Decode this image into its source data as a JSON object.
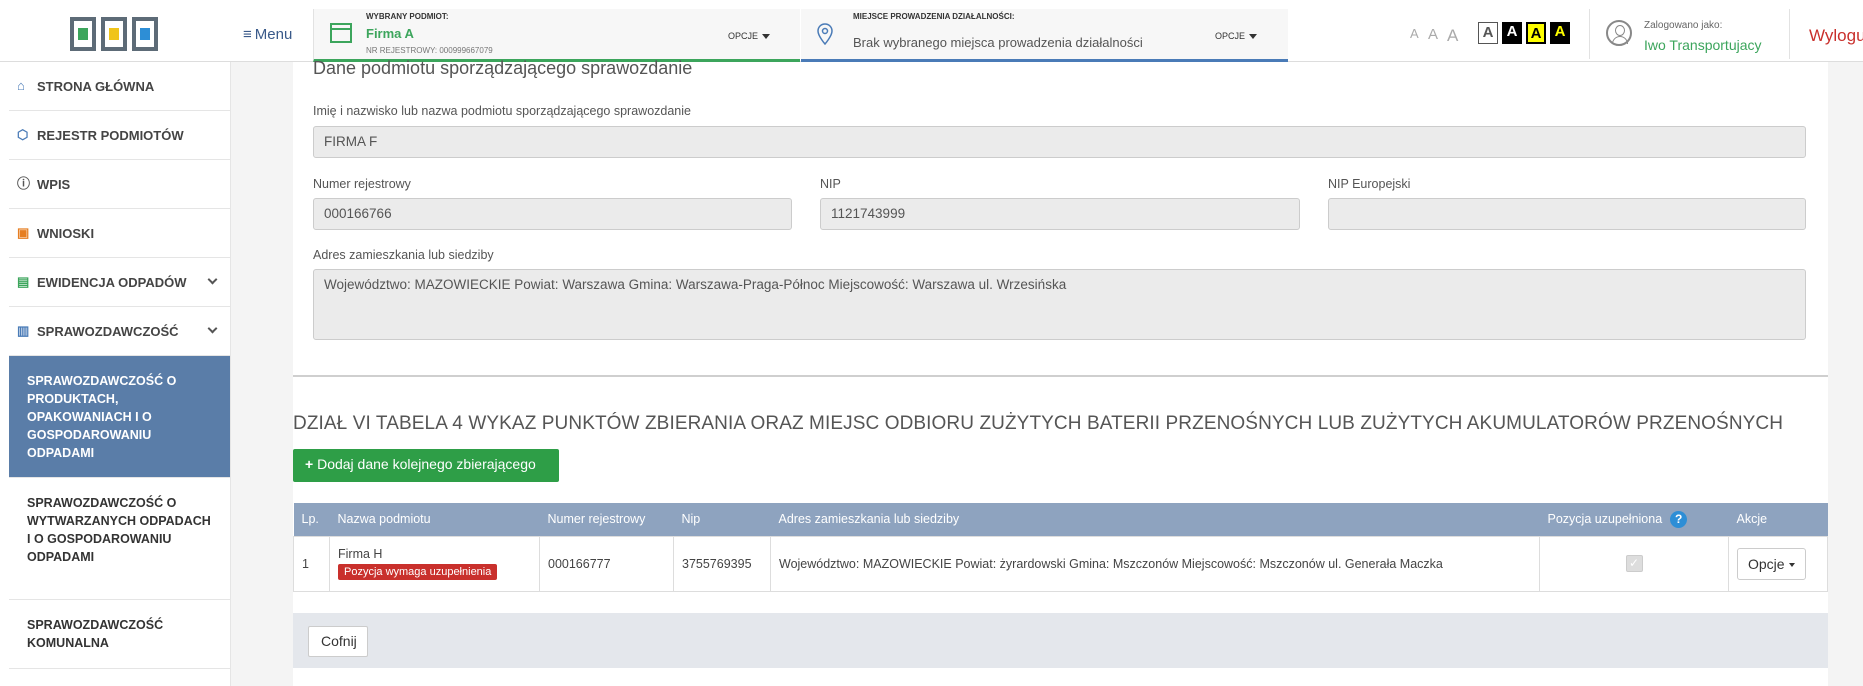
{
  "header": {
    "menu_label": "Menu",
    "subject": {
      "small_label": "WYBRANY PODMIOT:",
      "name": "Firma A",
      "reg_no": "NR REJESTROWY: 000999667079",
      "options": "OPCJE"
    },
    "place": {
      "small_label": "MIEJSCE PROWADZENIA DZIAŁALNOŚCI:",
      "value": "Brak wybranego miejsca prowadzenia działalności",
      "options": "OPCJE"
    },
    "font_sizes": [
      "A",
      "A",
      "A"
    ],
    "contrast_options": [
      "A",
      "A",
      "A",
      "A"
    ],
    "user_label": "Zalogowano jako:",
    "user_name": "Iwo Transportujacy",
    "logout": "Wylogu"
  },
  "sidebar": {
    "items": [
      {
        "label": "STRONA GŁÓWNA"
      },
      {
        "label": "REJESTR PODMIOTÓW"
      },
      {
        "label": "WPIS"
      },
      {
        "label": "WNIOSKI"
      },
      {
        "label": "EWIDENCJA ODPADÓW"
      },
      {
        "label": "SPRAWOZDAWCZOŚĆ"
      }
    ],
    "sub_items": [
      {
        "label": "SPRAWOZDAWCZOŚĆ O PRODUKTACH, OPAKOWANIACH I O GOSPODAROWANIU ODPADAMI"
      },
      {
        "label": "SPRAWOZDAWCZOŚĆ O WYTWARZANYCH ODPADACH I O GOSPODAROWANIU ODPADAMI"
      },
      {
        "label": "SPRAWOZDAWCZOŚĆ KOMUNALNA"
      }
    ]
  },
  "form": {
    "section_title": "Dane podmiotu sporządzającego sprawozdanie",
    "name_label": "Imię i nazwisko lub nazwa podmiotu sporządzającego sprawozdanie",
    "name_value": "FIRMA F",
    "reg_label": "Numer rejestrowy",
    "reg_value": "000166766",
    "nip_label": "NIP",
    "nip_value": "1121743999",
    "nip_eu_label": "NIP Europejski",
    "nip_eu_value": "",
    "address_label": "Adres zamieszkania lub siedziby",
    "address_value": "Województwo: MAZOWIECKIE Powiat: Warszawa Gmina: Warszawa-Praga-Północ Miejscowość: Warszawa ul. Wrzesińska"
  },
  "section2": {
    "title": "DZIAŁ VI TABELA 4 WYKAZ PUNKTÓW ZBIERANIA ORAZ MIEJSC ODBIORU ZUŻYTYCH BATERII PRZENOŚNYCH LUB ZUŻYTYCH AKUMULATORÓW PRZENOŚNYCH",
    "add_button": "Dodaj dane kolejnego zbierającego",
    "table": {
      "headers": [
        "Lp.",
        "Nazwa podmiotu",
        "Numer rejestrowy",
        "Nip",
        "Adres zamieszkania lub siedziby",
        "Pozycja uzupełniona",
        "Akcje"
      ],
      "rows": [
        {
          "lp": "1",
          "name": "Firma H",
          "badge": "Pozycja wymaga uzupełnienia",
          "reg": "000166777",
          "nip": "3755769395",
          "address": "Województwo: MAZOWIECKIE Powiat: żyrardowski Gmina: Mszczonów Miejscowość: Mszczonów ul. Generała Maczka",
          "completed": true,
          "action": "Opcje"
        }
      ]
    },
    "back_button": "Cofnij"
  },
  "colors": {
    "green": "#2e9e47",
    "blue_header": "#8ea3bf",
    "sidebar_active": "#5a7da8",
    "danger": "#c9302c"
  }
}
